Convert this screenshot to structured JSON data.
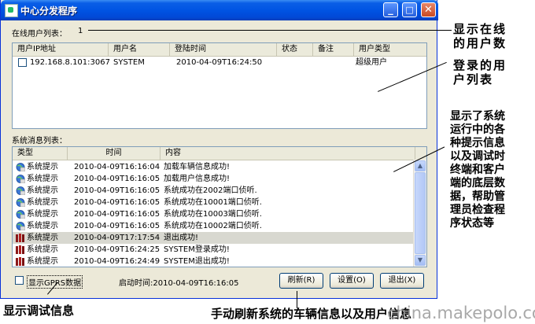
{
  "window": {
    "title": "中心分发程序"
  },
  "online": {
    "label": "在线用户列表：",
    "count": "1",
    "columns": [
      "用户IP地址",
      "用户名",
      "登陆时间",
      "状态",
      "备注",
      "用户类型"
    ],
    "rows": [
      {
        "ip": "192.168.8.101:3067",
        "user": "SYSTEM",
        "time": "2010-04-09T16:24:50",
        "status": "",
        "note": "",
        "type": "超级用户"
      }
    ]
  },
  "messages": {
    "label": "系统消息列表：",
    "columns": [
      "类型",
      "时间",
      "内容"
    ],
    "rows": [
      {
        "type": "系统提示",
        "time": "2010-04-09T16:16:04",
        "content": "加载车辆信息成功!",
        "icon": "globe-info-icon",
        "selected": false
      },
      {
        "type": "系统提示",
        "time": "2010-04-09T16:16:05",
        "content": "加载用户信息成功!",
        "icon": "globe-info-icon",
        "selected": false
      },
      {
        "type": "系统提示",
        "time": "2010-04-09T16:16:05",
        "content": "系统成功在2002端口侦听.",
        "icon": "globe-info-icon",
        "selected": false
      },
      {
        "type": "系统提示",
        "time": "2010-04-09T16:16:05",
        "content": "系统成功在10001端口侦听.",
        "icon": "globe-info-icon",
        "selected": false
      },
      {
        "type": "系统提示",
        "time": "2010-04-09T16:16:05",
        "content": "系统成功在10003端口侦听.",
        "icon": "globe-info-icon",
        "selected": false
      },
      {
        "type": "系统提示",
        "time": "2010-04-09T16:16:05",
        "content": "系统成功在10002端口侦听.",
        "icon": "globe-info-icon",
        "selected": false
      },
      {
        "type": "系统提示",
        "time": "2010-04-09T17:17:54",
        "content": "退出成功!",
        "icon": "books-icon",
        "selected": true
      },
      {
        "type": "系统提示",
        "time": "2010-04-09T16:24:25",
        "content": "SYSTEM登录成功!",
        "icon": "books-icon",
        "selected": false
      },
      {
        "type": "系统提示",
        "time": "2010-04-09T16:24:49",
        "content": "SYSTEM退出成功!",
        "icon": "books-icon",
        "selected": false
      }
    ]
  },
  "footer": {
    "debug_checkbox": "显示GPRS数据",
    "start_time": "启动时间:2010-04-09T16:16:05",
    "refresh": "刷新(R)",
    "settings": "设置(O)",
    "exit": "退出(X)"
  },
  "annotations": {
    "online_count": "显示在线\n的用户数",
    "user_list": "登录的用\n户列表",
    "message_list": "显示了系统\n运行中的各\n种提示信息\n以及调试时\n终端和客户\n端的底层数\n据，帮助管\n理员检查程\n序状态等",
    "debug": "显示调试信息",
    "refresh": "手动刷新系统的车辆信息以及用户信息"
  },
  "watermark": "china.makepolo.com"
}
